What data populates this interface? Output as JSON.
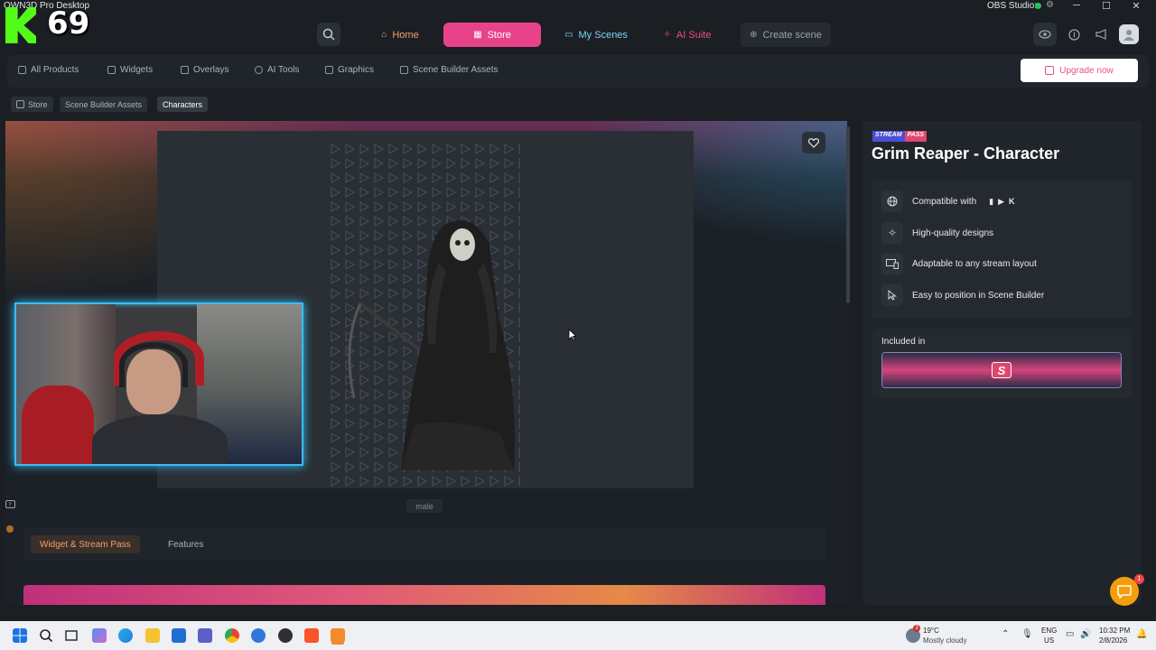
{
  "titlebar": {
    "app_title": "OWN3D Pro Desktop",
    "obs_label": "OBS Studio:"
  },
  "overlay": {
    "badge_number": "69"
  },
  "topnav": {
    "home": "Home",
    "store": "Store",
    "my_scenes": "My Scenes",
    "ai_suite": "AI Suite",
    "create_scene": "Create scene"
  },
  "subnav": {
    "items": [
      "All Products",
      "Widgets",
      "Overlays",
      "AI Tools",
      "Graphics",
      "Scene Builder Assets"
    ],
    "upgrade": "Upgrade now"
  },
  "breadcrumb": [
    "Store",
    "Scene Builder Assets",
    "Characters"
  ],
  "preview": {
    "tag": "male"
  },
  "tabs": {
    "active": "Widget & Stream Pass",
    "other": "Features"
  },
  "product": {
    "badge_a": "STREAM",
    "badge_b": "PASS",
    "title": "Grim Reaper - Character",
    "features": [
      "Compatible with",
      "High-quality designs",
      "Adaptable to any stream layout",
      "Easy to position in Scene Builder"
    ],
    "included_label": "Included in",
    "included_logo": "S"
  },
  "chat": {
    "badge": "1"
  },
  "taskbar": {
    "weather_temp": "19°C",
    "weather_desc": "Mostly cloudy",
    "weather_badge": "3",
    "lang1": "ENG",
    "lang2": "US",
    "time": "10:32 PM",
    "date": "2/8/2026"
  },
  "colors": {
    "accent": "#e8438a",
    "kick_green": "#53fc18",
    "webcam_glow": "#38bdf8"
  }
}
